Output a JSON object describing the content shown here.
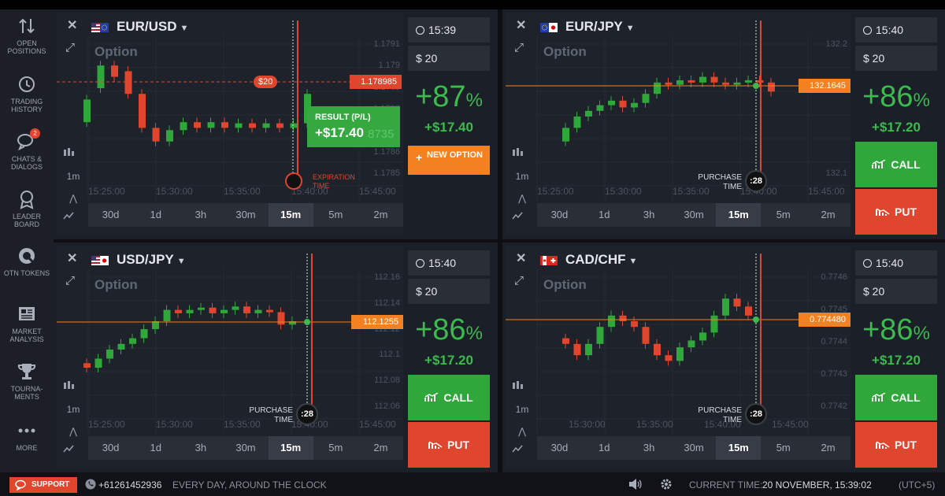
{
  "colors": {
    "call": "#2fa73b",
    "put": "#e0452d",
    "accent_orange": "#f4811f",
    "sidebar": "#1c1f26",
    "panel": "#1e222b"
  },
  "sidebar": [
    {
      "icon": "arrows-up-down-icon",
      "label": "OPEN POSITIONS"
    },
    {
      "icon": "history-clock-icon",
      "label": "TRADING HISTORY"
    },
    {
      "icon": "chat-bubbles-icon",
      "label": "CHATS & DIALOGS",
      "badge": "2"
    },
    {
      "icon": "medal-icon",
      "label": "LEADER BOARD"
    },
    {
      "icon": "otn-token-icon",
      "label": "OTN TOKENS"
    },
    {
      "icon": "newspaper-icon",
      "label": "MARKET ANALYSIS"
    },
    {
      "icon": "trophy-icon",
      "label": "TOURNA-MENTS"
    },
    {
      "icon": "more-dots-icon",
      "label": "MORE"
    }
  ],
  "timeframes": [
    "30d",
    "1d",
    "3h",
    "30m",
    "15m",
    "5m",
    "2m"
  ],
  "active_timeframe": "15m",
  "candle_interval": "1m",
  "panels": [
    {
      "pair": "EUR/USD",
      "option_label": "Option",
      "time_axis": [
        "15:25:00",
        "15:30:00",
        "15:35:00",
        "15:40:00",
        "15:45:00"
      ],
      "price_scale": [
        "1.1791",
        "1.179",
        "1.1789",
        "1.1788",
        "1.1787",
        "1.1786",
        "1.1785"
      ],
      "price_tag": "1.178985",
      "bet_marker": "$20",
      "result_label": "RESULT (P/L)",
      "result_value": "+$17.40",
      "result_bg": "8735",
      "expiration_label": "EXPIRATION TIME",
      "expiry_time": "15:39",
      "amount": "$ 20",
      "payout": "+87",
      "profit": "+$17.40",
      "new_option": "NEW OPTION"
    },
    {
      "pair": "EUR/JPY",
      "option_label": "Option",
      "time_axis": [
        "15:25:00",
        "15:30:00",
        "15:35:00",
        "15:40:00",
        "15:45:00"
      ],
      "price_scale": [
        "132.2",
        "132.1"
      ],
      "price_tag": "132.1645",
      "purchase_label": "PURCHASE TIME",
      "timer": ":28",
      "expiry_time": "15:40",
      "amount": "$ 20",
      "payout": "+86",
      "profit": "+$17.20",
      "call": "CALL",
      "put": "PUT"
    },
    {
      "pair": "USD/JPY",
      "option_label": "Option",
      "time_axis": [
        "15:25:00",
        "15:30:00",
        "15:35:00",
        "15:40:00",
        "15:45:00"
      ],
      "price_scale": [
        "112.16",
        "112.14",
        "112.12",
        "112.1",
        "112.08",
        "112.06"
      ],
      "price_tag": "112.1255",
      "purchase_label": "PURCHASE TIME",
      "timer": ":28",
      "expiry_time": "15:40",
      "amount": "$ 20",
      "payout": "+86",
      "profit": "+$17.20",
      "call": "CALL",
      "put": "PUT"
    },
    {
      "pair": "CAD/CHF",
      "option_label": "Option",
      "time_axis": [
        "15:30:00",
        "15:35:00",
        "15:40:00",
        "15:45:00"
      ],
      "price_scale": [
        "0.7746",
        "0.7745",
        "0.7744",
        "0.7743",
        "0.7742"
      ],
      "price_tag": "0.774480",
      "purchase_label": "PURCHASE TIME",
      "timer": ":28",
      "expiry_time": "15:40",
      "amount": "$ 20",
      "payout": "+86",
      "profit": "+$17.20",
      "call": "CALL",
      "put": "PUT"
    }
  ],
  "footer": {
    "support": "SUPPORT",
    "phone": "+61261452936",
    "hours": "EVERY DAY, AROUND THE CLOCK",
    "current_time_label": "CURRENT TIME:",
    "current_time": "20 NOVEMBER, 15:39:02",
    "timezone": "(UTC+5)"
  }
}
